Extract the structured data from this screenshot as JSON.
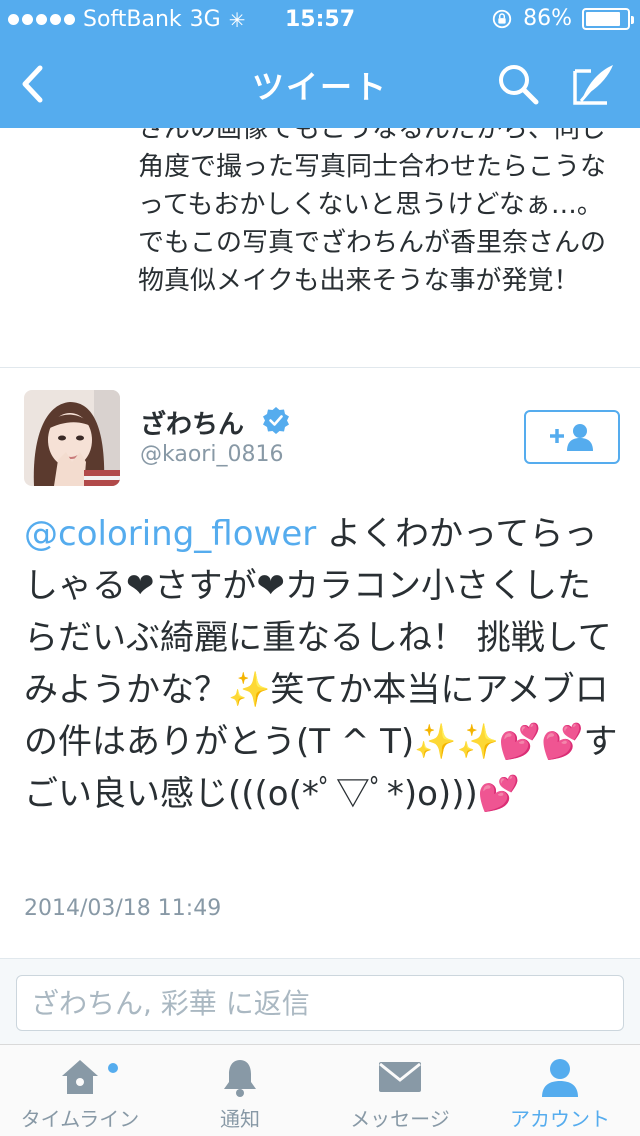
{
  "status_bar": {
    "carrier": "SoftBank",
    "network": "3G",
    "time": "15:57",
    "battery": "86%",
    "battery_level": 0.86
  },
  "nav": {
    "title": "ツイート",
    "back_icon": "chevron-left-icon",
    "search_icon": "search-icon",
    "compose_icon": "compose-icon"
  },
  "previous_tweet": {
    "text": "さんの画像でもこうなるんだから、同じ角度で撮った写真同士合わせたらこうなってもおかしくないと思うけどなぁ…。でもこの写真でざわちんが香里奈さんの物真似メイクも出来そうな事が発覚！"
  },
  "tweet": {
    "display_name": "ざわちん",
    "handle": "@kaori_0816",
    "verified": true,
    "follow_icon": "follow-user-icon",
    "text": {
      "mention": "@coloring_flower",
      "part1": " よくわかってらっしゃる",
      "heart": "❤",
      "part2": "さすが",
      "part3": "カラコン小さくしたらだいぶ綺麗に重なるしね！ 挑戦してみようかな？",
      "sparkle": "✨",
      "part4": "笑てか本当にアメブロの件はありがとう(T ^ T)",
      "hearts": "💕",
      "part5": "すごい良い感じ(((o(*ﾟ▽ﾟ*)o)))"
    },
    "date": "2014/03/18 11:49"
  },
  "reply": {
    "placeholder": "ざわちん, 彩華 に返信"
  },
  "tabs": [
    {
      "label": "タイムライン",
      "icon": "home-icon",
      "active": false,
      "has_notification": true
    },
    {
      "label": "通知",
      "icon": "bell-icon",
      "active": false
    },
    {
      "label": "メッセージ",
      "icon": "envelope-icon",
      "active": false
    },
    {
      "label": "アカウント",
      "icon": "person-icon",
      "active": true
    }
  ],
  "colors": {
    "brand_blue": "#55acee",
    "text": "#292f33",
    "muted": "#8899a6",
    "verified": "#55acee"
  }
}
